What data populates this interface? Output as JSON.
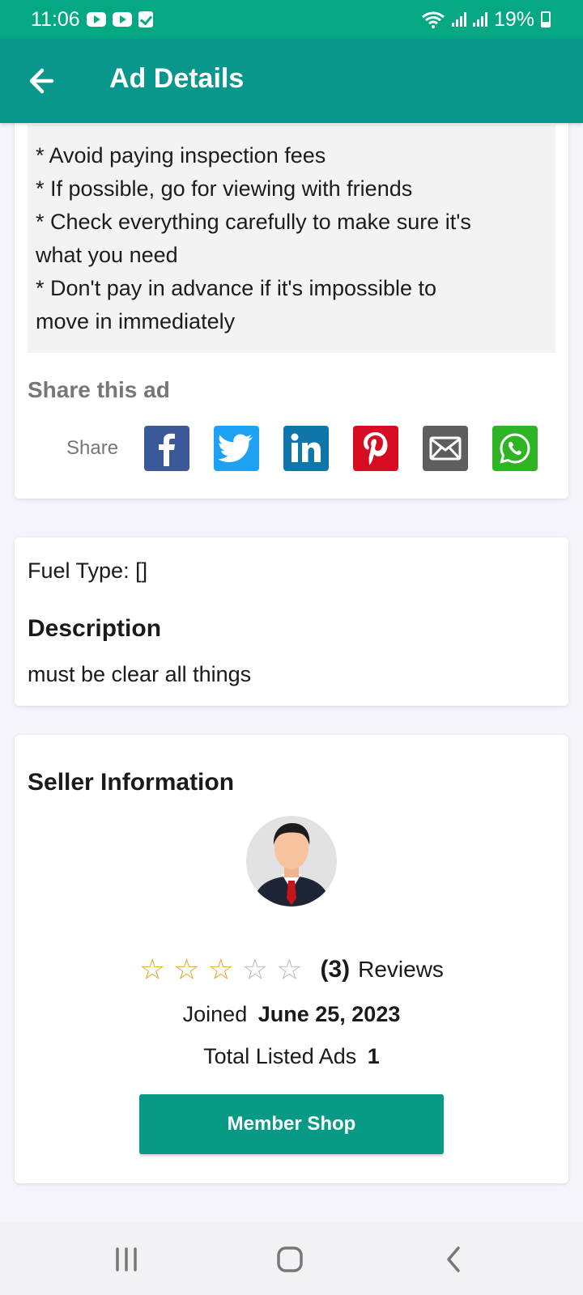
{
  "status_bar": {
    "time": "11:06",
    "battery": "19%"
  },
  "app_bar": {
    "title": "Ad Details"
  },
  "safety_tips": [
    "* Avoid paying inspection fees",
    "* If possible, go for viewing with friends",
    "* Check everything carefully to make sure it's",
    "what you need",
    "* Don't pay in advance if it's impossible to",
    "move in immediately"
  ],
  "share": {
    "title": "Share this ad",
    "label": "Share",
    "buttons": [
      {
        "name": "facebook",
        "icon": "facebook-icon",
        "color": "#3b5998"
      },
      {
        "name": "twitter",
        "icon": "twitter-icon",
        "color": "#1da1f2"
      },
      {
        "name": "linkedin",
        "icon": "linkedin-icon",
        "color": "#0e76a8"
      },
      {
        "name": "pinterest",
        "icon": "pinterest-icon",
        "color": "#d50c22"
      },
      {
        "name": "email",
        "icon": "email-icon",
        "color": "#5e5e5e"
      },
      {
        "name": "whatsapp",
        "icon": "whatsapp-icon",
        "color": "#2fb425"
      }
    ]
  },
  "details": {
    "fuel_type": "Fuel Type: []",
    "description_title": "Description",
    "description_text": "must be clear all things"
  },
  "seller": {
    "title": "Seller Information",
    "rating": 3,
    "rating_max": 5,
    "review_count": "(3)",
    "review_label": "Reviews",
    "joined_label": "Joined",
    "joined_date": "June 25, 2023",
    "ads_label": "Total Listed Ads",
    "ads_count": "1",
    "shop_button": "Member Shop"
  },
  "colors": {
    "status_bar": "#05a883",
    "app_bar": "#08978a",
    "accent": "#079b85",
    "star": "#e8a526"
  }
}
